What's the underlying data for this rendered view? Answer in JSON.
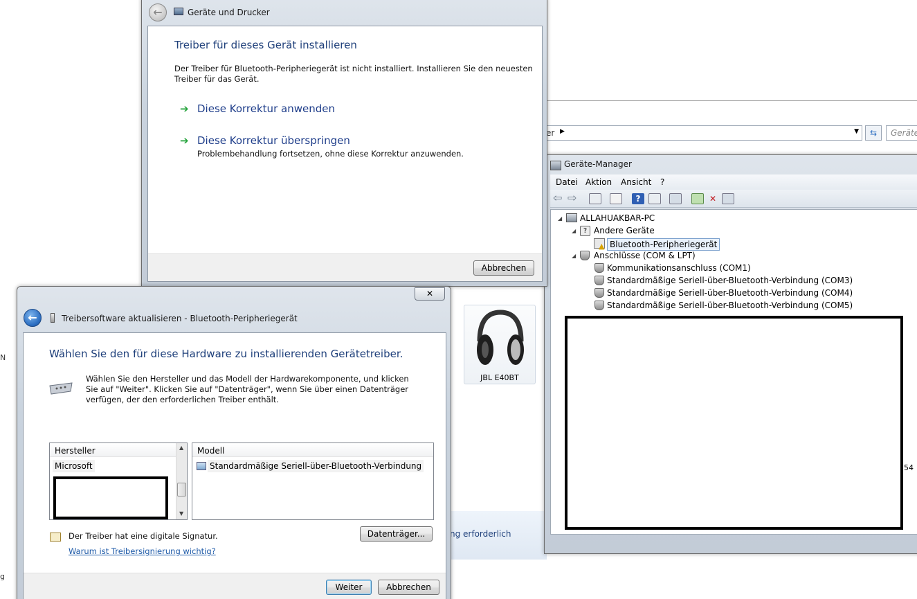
{
  "devices_window": {
    "title": "Geräte und Drucker",
    "heading": "Treiber für dieses Gerät installieren",
    "description": "Der Treiber für Bluetooth-Peripheriegerät ist nicht installiert. Installieren Sie den neuesten Treiber für das Gerät.",
    "option1_label": "Diese Korrektur anwenden",
    "option2_label": "Diese Korrektur überspringen",
    "option2_sub": "Problembehandlung fortsetzen, ohne diese Korrektur anzuwenden.",
    "cancel_label": "Abbrechen"
  },
  "explorer_bg": {
    "breadcrumb_fragment": "er",
    "search_placeholder": "Geräte",
    "device_name": "JBL E40BT",
    "fragment_text": "ng erforderlich",
    "fragment_number": "54"
  },
  "device_manager": {
    "title": "Geräte-Manager",
    "menu": [
      "Datei",
      "Aktion",
      "Ansicht",
      "?"
    ],
    "tree": {
      "root": "ALLAHUAKBAR-PC",
      "group1": "Andere Geräte",
      "group1_item": "Bluetooth-Peripheriegerät",
      "group2": "Anschlüsse (COM & LPT)",
      "ports": [
        "Kommunikationsanschluss (COM1)",
        "Standardmäßige Seriell-über-Bluetooth-Verbindung (COM3)",
        "Standardmäßige Seriell-über-Bluetooth-Verbindung (COM4)",
        "Standardmäßige Seriell-über-Bluetooth-Verbindung (COM5)"
      ]
    }
  },
  "driver_dialog": {
    "title": "Treibersoftware aktualisieren - Bluetooth-Peripheriegerät",
    "heading": "Wählen Sie den für diese Hardware zu installierenden Gerätetreiber.",
    "instructions": "Wählen Sie den Hersteller und das Modell der Hardwarekomponente, und klicken Sie auf \"Weiter\". Klicken Sie auf \"Datenträger\", wenn Sie über einen Datenträger verfügen, der den erforderlichen Treiber enthält.",
    "manufacturer_header": "Hersteller",
    "manufacturer_item": "Microsoft",
    "model_header": "Modell",
    "model_item": "Standardmäßige Seriell-über-Bluetooth-Verbindung",
    "signature_text": "Der Treiber hat eine digitale Signatur.",
    "signature_link": "Warum ist Treibersignierung wichtig?",
    "disk_button": "Datenträger...",
    "next_button": "Weiter",
    "cancel_button": "Abbrechen",
    "close_glyph": "✕"
  },
  "colors": {
    "link_blue": "#1e3d8a",
    "heading_blue": "#1e3f7a",
    "arrow_green": "#23a23a",
    "selection_border": "#7da2ce"
  }
}
